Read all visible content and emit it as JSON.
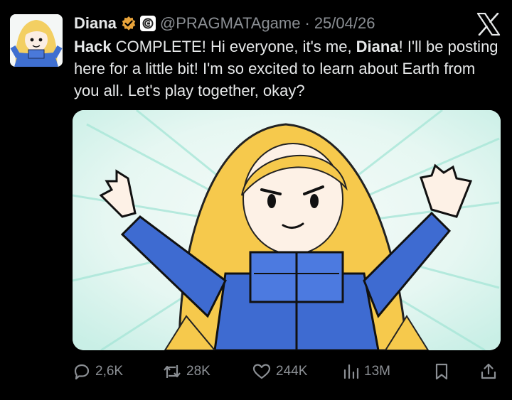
{
  "tweet": {
    "author": {
      "display_name": "Diana",
      "verified_icon": "gold-checkmark-badge-icon",
      "affiliate_icon": "pragmata-logo-icon",
      "handle": "@PRAGMATAgame",
      "separator": "·",
      "date": "25/04/26"
    },
    "platform_icon": "x-logo-icon",
    "text": {
      "part1": "Hack",
      "part2": " COMPLETE! Hi everyone, it's me, ",
      "part3": "Diana",
      "part4": "! I'll be posting here for a little bit! I'm so excited to learn about Earth from you all. Let's play together, okay?"
    },
    "media": {
      "icon": "crayon-drawing-of-diana-image"
    },
    "actions": {
      "replies": "2,6K",
      "reposts": "28K",
      "likes": "244K",
      "views": "13M"
    }
  },
  "colors": {
    "background": "#000000",
    "text": "#e7e9ea",
    "muted": "#8b8f94",
    "verified_gold": "#e8a33a"
  }
}
